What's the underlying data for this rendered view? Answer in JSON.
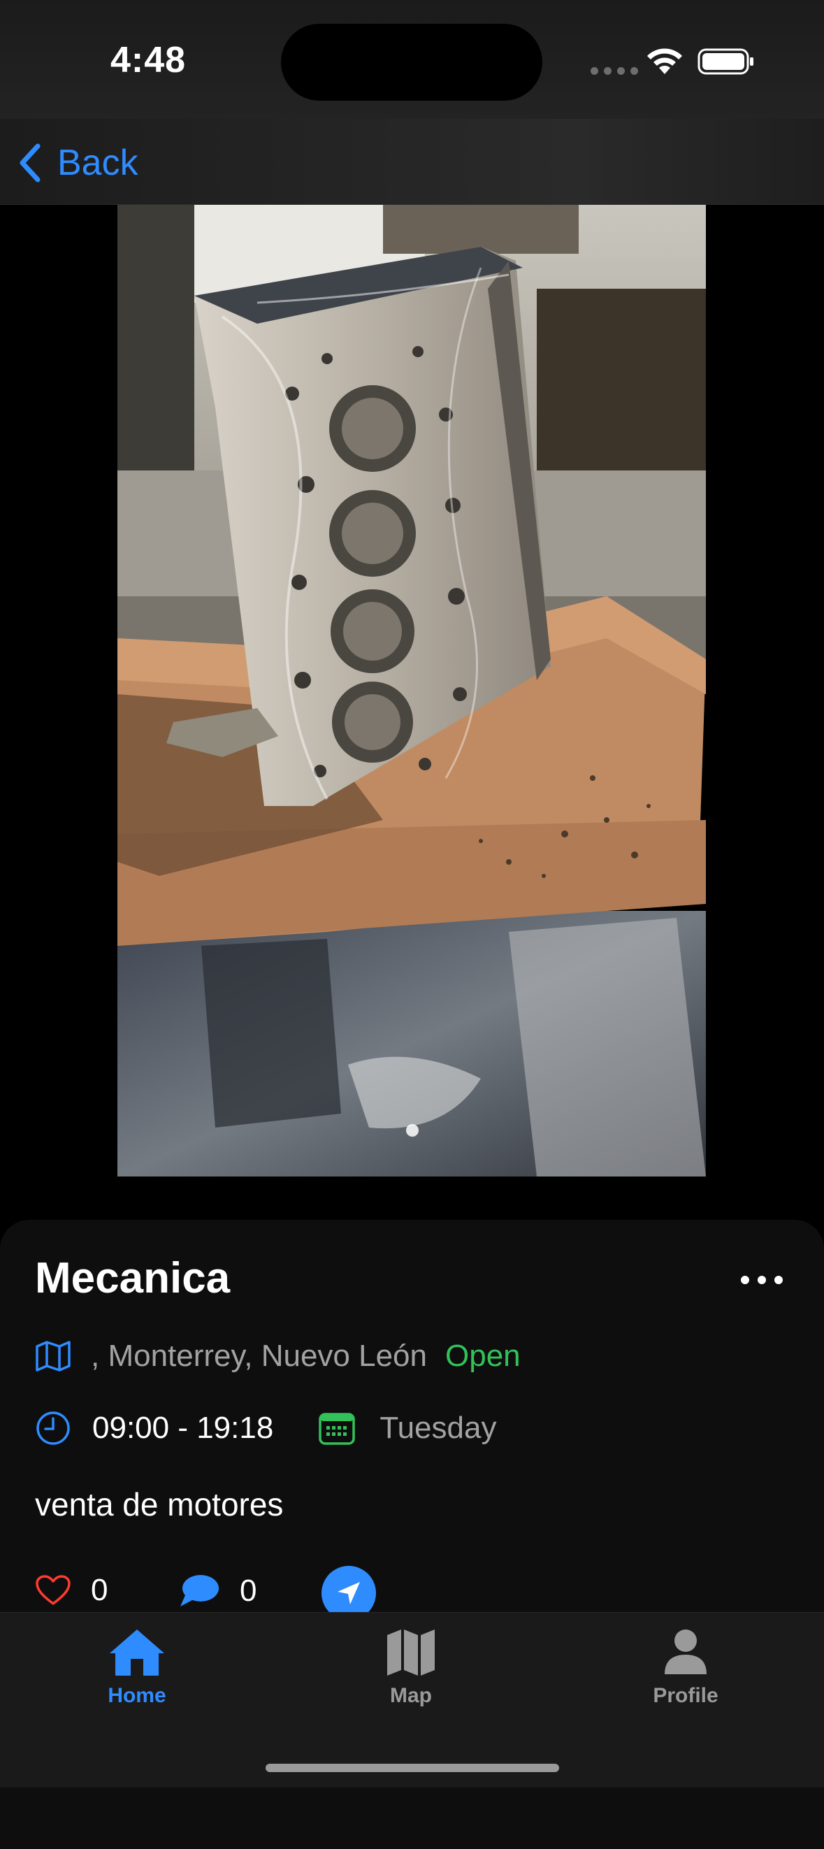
{
  "status_bar": {
    "time": "4:48"
  },
  "nav": {
    "back_label": "Back"
  },
  "listing": {
    "title": "Mecanica",
    "location": ", Monterrey, Nuevo León",
    "status": "Open",
    "hours": "09:00 - 19:18",
    "day": "Tuesday",
    "description": "venta de motores",
    "likes": "0",
    "comments": "0"
  },
  "tabs": [
    {
      "label": "Home",
      "icon": "house-icon",
      "active": true
    },
    {
      "label": "Map",
      "icon": "map-icon",
      "active": false
    },
    {
      "label": "Profile",
      "icon": "person-icon",
      "active": false
    }
  ],
  "colors": {
    "accent": "#2f8cff",
    "open": "#33c15a",
    "like": "#ff3b30",
    "calendar": "#33c15a",
    "inactive": "#9a9a9a"
  }
}
